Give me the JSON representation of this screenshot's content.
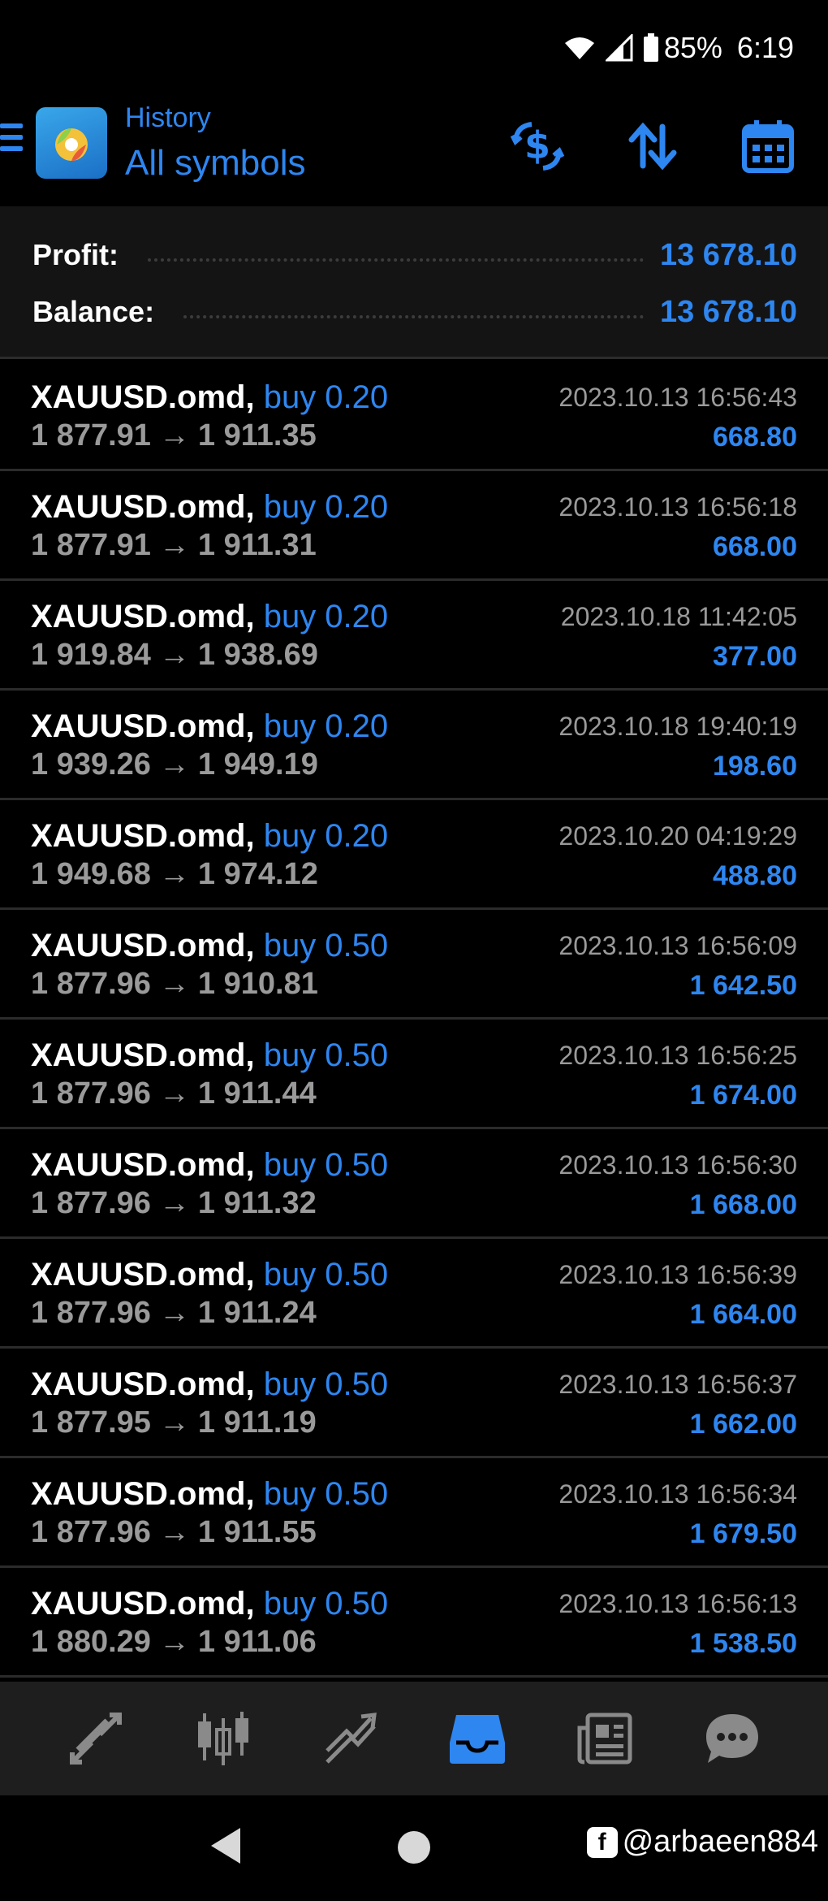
{
  "status_bar": {
    "battery": "85%",
    "time": "6:19",
    "icons": [
      "wifi-icon",
      "signal-icon",
      "battery-icon"
    ]
  },
  "header": {
    "subtitle": "History",
    "title": "All symbols",
    "actions": [
      "currency-exchange-icon",
      "sort-icon",
      "calendar-icon"
    ],
    "accent_color": "#2e86f0"
  },
  "summary": {
    "profit_label": "Profit:",
    "profit_value": "13 678.10",
    "balance_label": "Balance:",
    "balance_value": "13 678.10"
  },
  "trades": [
    {
      "symbol": "XAUUSD.omd,",
      "side": "buy 0.20",
      "open": "1 877.91",
      "close": "1 911.35",
      "time": "2023.10.13 16:56:43",
      "profit": "668.80"
    },
    {
      "symbol": "XAUUSD.omd,",
      "side": "buy 0.20",
      "open": "1 877.91",
      "close": "1 911.31",
      "time": "2023.10.13 16:56:18",
      "profit": "668.00"
    },
    {
      "symbol": "XAUUSD.omd,",
      "side": "buy 0.20",
      "open": "1 919.84",
      "close": "1 938.69",
      "time": "2023.10.18 11:42:05",
      "profit": "377.00"
    },
    {
      "symbol": "XAUUSD.omd,",
      "side": "buy 0.20",
      "open": "1 939.26",
      "close": "1 949.19",
      "time": "2023.10.18 19:40:19",
      "profit": "198.60"
    },
    {
      "symbol": "XAUUSD.omd,",
      "side": "buy 0.20",
      "open": "1 949.68",
      "close": "1 974.12",
      "time": "2023.10.20 04:19:29",
      "profit": "488.80"
    },
    {
      "symbol": "XAUUSD.omd,",
      "side": "buy 0.50",
      "open": "1 877.96",
      "close": "1 910.81",
      "time": "2023.10.13 16:56:09",
      "profit": "1 642.50"
    },
    {
      "symbol": "XAUUSD.omd,",
      "side": "buy 0.50",
      "open": "1 877.96",
      "close": "1 911.44",
      "time": "2023.10.13 16:56:25",
      "profit": "1 674.00"
    },
    {
      "symbol": "XAUUSD.omd,",
      "side": "buy 0.50",
      "open": "1 877.96",
      "close": "1 911.32",
      "time": "2023.10.13 16:56:30",
      "profit": "1 668.00"
    },
    {
      "symbol": "XAUUSD.omd,",
      "side": "buy 0.50",
      "open": "1 877.96",
      "close": "1 911.24",
      "time": "2023.10.13 16:56:39",
      "profit": "1 664.00"
    },
    {
      "symbol": "XAUUSD.omd,",
      "side": "buy 0.50",
      "open": "1 877.95",
      "close": "1 911.19",
      "time": "2023.10.13 16:56:37",
      "profit": "1 662.00"
    },
    {
      "symbol": "XAUUSD.omd,",
      "side": "buy 0.50",
      "open": "1 877.96",
      "close": "1 911.55",
      "time": "2023.10.13 16:56:34",
      "profit": "1 679.50"
    },
    {
      "symbol": "XAUUSD.omd,",
      "side": "buy 0.50",
      "open": "1 880.29",
      "close": "1 911.06",
      "time": "2023.10.13 16:56:13",
      "profit": "1 538.50"
    }
  ],
  "tabbar": {
    "tabs": [
      "quotes-icon",
      "chart-icon",
      "trade-icon",
      "history-icon",
      "news-icon",
      "chat-icon"
    ],
    "active": "history-icon"
  },
  "navbar": {
    "watermark": "@arbaeen884"
  }
}
